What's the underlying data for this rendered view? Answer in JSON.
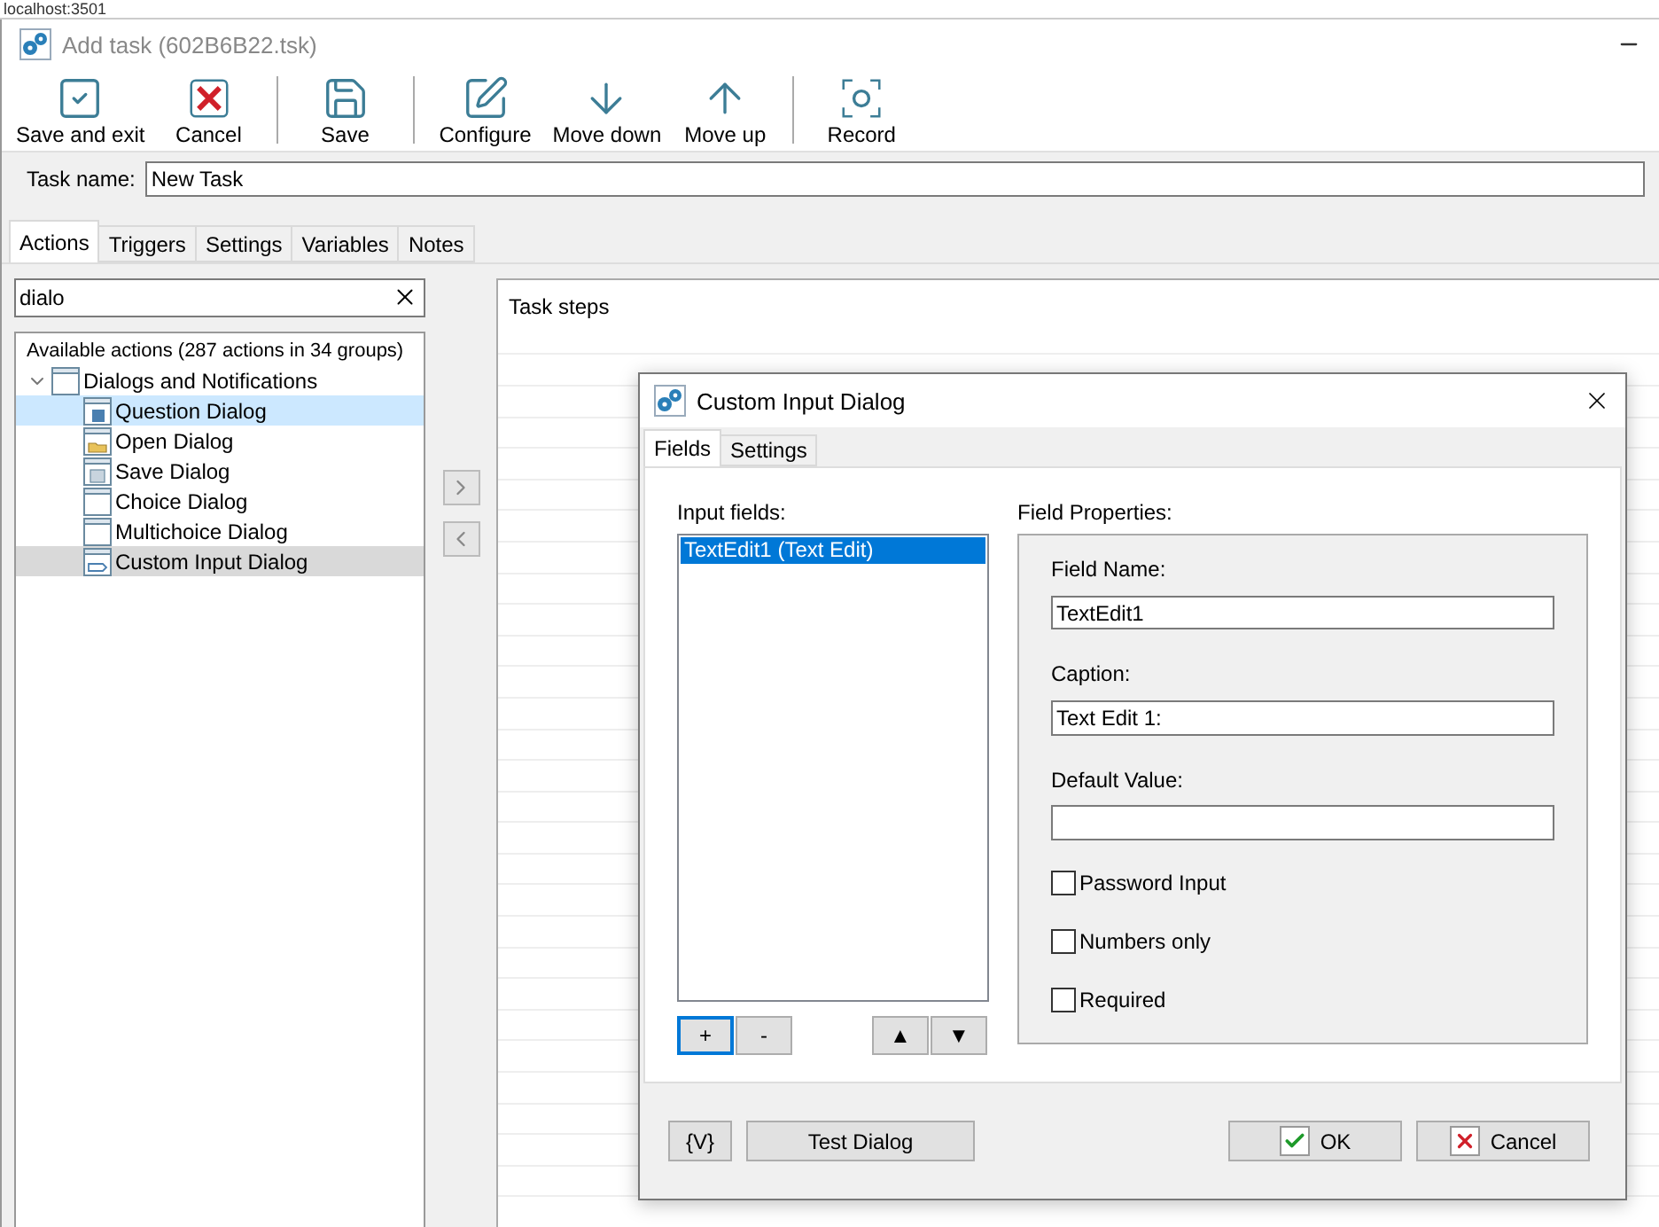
{
  "browser_strip": {
    "text": "localhost:3501"
  },
  "window": {
    "title": "Add task (602B6B22.tsk)"
  },
  "toolbar": [
    {
      "kind": "button",
      "label": "Save and exit"
    },
    {
      "kind": "button",
      "label": "Cancel"
    },
    {
      "kind": "separator"
    },
    {
      "kind": "button",
      "label": "Save"
    },
    {
      "kind": "separator"
    },
    {
      "kind": "button",
      "label": "Configure"
    },
    {
      "kind": "button",
      "label": "Move down"
    },
    {
      "kind": "button",
      "label": "Move up"
    },
    {
      "kind": "separator"
    },
    {
      "kind": "button",
      "label": "Record"
    }
  ],
  "task_name": {
    "label": "Task name:",
    "value": "New Task"
  },
  "tabs": [
    {
      "label": "Actions",
      "selected": true
    },
    {
      "label": "Triggers",
      "selected": false
    },
    {
      "label": "Settings",
      "selected": false
    },
    {
      "label": "Variables",
      "selected": false
    },
    {
      "label": "Notes",
      "selected": false
    }
  ],
  "search": {
    "value": "dialo"
  },
  "actions_tree": {
    "header": "Available actions (287 actions in 34 groups)",
    "groups": [
      {
        "label": "Dialogs and Notifications",
        "expanded": true,
        "children": [
          {
            "label": "Question Dialog",
            "hovered": true,
            "selected": false
          },
          {
            "label": "Open Dialog",
            "hovered": false,
            "selected": false
          },
          {
            "label": "Save Dialog",
            "hovered": false,
            "selected": false
          },
          {
            "label": "Choice Dialog",
            "hovered": false,
            "selected": false
          },
          {
            "label": "Multichoice Dialog",
            "hovered": false,
            "selected": false
          },
          {
            "label": "Custom Input Dialog",
            "hovered": false,
            "selected": true
          }
        ]
      }
    ]
  },
  "task_steps": {
    "title": "Task steps"
  },
  "dialog": {
    "title": "Custom Input Dialog",
    "tabs": [
      {
        "label": "Fields",
        "selected": true
      },
      {
        "label": "Settings",
        "selected": false
      }
    ],
    "input_fields": {
      "label": "Input fields:",
      "items": [
        {
          "label": "TextEdit1 (Text Edit)",
          "selected": true
        }
      ]
    },
    "list_buttons": [
      {
        "label": "+",
        "focused": true
      },
      {
        "label": "-",
        "focused": false
      },
      {
        "label": "▲",
        "focused": false
      },
      {
        "label": "▼",
        "focused": false
      }
    ],
    "field_properties": {
      "title": "Field Properties:",
      "fields": [
        {
          "label": "Field Name:",
          "value": "TextEdit1"
        },
        {
          "label": "Caption:",
          "value": "Text Edit 1:"
        },
        {
          "label": "Default Value:"
        }
      ],
      "checkboxes": [
        {
          "label": "Password Input",
          "checked": false
        },
        {
          "label": "Numbers only",
          "checked": false
        },
        {
          "label": "Required",
          "checked": false
        }
      ]
    },
    "left_buttons": [
      "{V}",
      "Test Dialog"
    ],
    "buttons": [
      {
        "label": "OK",
        "kind": "ok"
      },
      {
        "label": "Cancel",
        "kind": "cancel"
      }
    ]
  }
}
